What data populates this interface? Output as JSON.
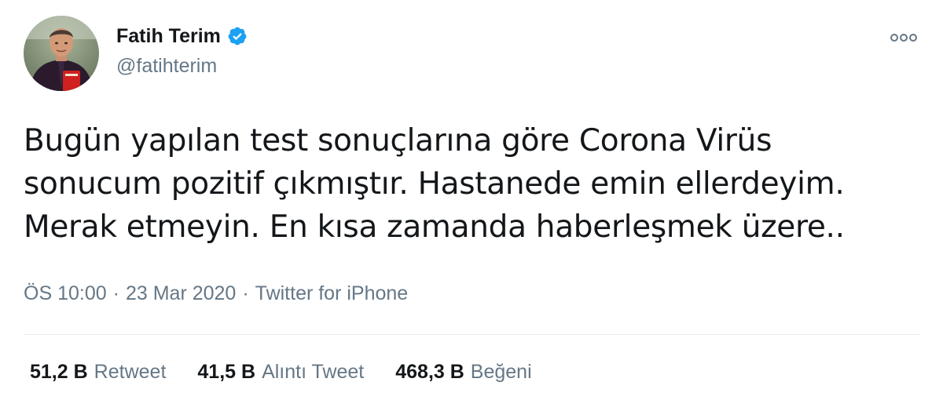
{
  "tweet": {
    "author": {
      "display_name": "Fatih Terim",
      "handle": "@fatihterim",
      "verified_icon": "verified-badge-icon"
    },
    "more_icon": "more-options-icon",
    "text_lines": [
      "Bugün yapılan test sonuçlarına göre Corona Virüs",
      "sonucum pozitif çıkmıştır. Hastanede emin ellerdeyim.",
      "Merak etmeyin. En kısa zamanda haberleşmek üzere.."
    ],
    "meta": {
      "time": "ÖS 10:00",
      "separator": "·",
      "date": "23 Mar 2020",
      "source": "Twitter for iPhone"
    },
    "stats": [
      {
        "count": "51,2 B",
        "label": "Retweet"
      },
      {
        "count": "41,5 B",
        "label": "Alıntı Tweet"
      },
      {
        "count": "468,3 B",
        "label": "Beğeni"
      }
    ]
  },
  "colors": {
    "text_primary": "#14171a",
    "text_secondary": "#657786",
    "verified_blue": "#1da1f2",
    "divider": "#e6ecf0"
  }
}
